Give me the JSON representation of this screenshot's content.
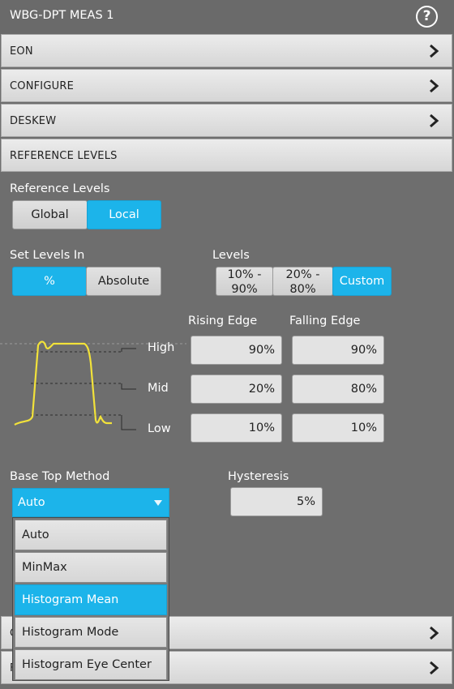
{
  "window": {
    "title": "WBG-DPT MEAS 1"
  },
  "sections": [
    {
      "label": "EON"
    },
    {
      "label": "CONFIGURE"
    },
    {
      "label": "DESKEW"
    },
    {
      "label": "REFERENCE LEVELS"
    }
  ],
  "hidden_sections": [
    {
      "label": "C"
    },
    {
      "label": "F"
    }
  ],
  "reference_levels": {
    "label": "Reference Levels",
    "options": [
      "Global",
      "Local"
    ],
    "selected": "Local"
  },
  "set_levels_in": {
    "label": "Set Levels In",
    "options": [
      "%",
      "Absolute"
    ],
    "selected": "%"
  },
  "levels": {
    "label": "Levels",
    "presets": [
      {
        "line1": "10% -",
        "line2": "90%"
      },
      {
        "line1": "20% -",
        "line2": "80%"
      }
    ],
    "custom_label": "Custom",
    "selected": "Custom"
  },
  "edges": {
    "rising_label": "Rising Edge",
    "falling_label": "Falling Edge",
    "rows": [
      {
        "name": "High",
        "rising": "90%",
        "falling": "90%"
      },
      {
        "name": "Mid",
        "rising": "20%",
        "falling": "80%"
      },
      {
        "name": "Low",
        "rising": "10%",
        "falling": "10%"
      }
    ]
  },
  "base_top_method": {
    "label": "Base Top Method",
    "value": "Auto",
    "options": [
      "Auto",
      "MinMax",
      "Histogram Mean",
      "Histogram Mode",
      "Histogram Eye Center"
    ],
    "highlighted": "Histogram Mean"
  },
  "hysteresis": {
    "label": "Hysteresis",
    "value": "5%"
  },
  "colors": {
    "accent": "#1cb4ea",
    "background": "#6e6e6e",
    "waveform": "#f2e23a"
  }
}
